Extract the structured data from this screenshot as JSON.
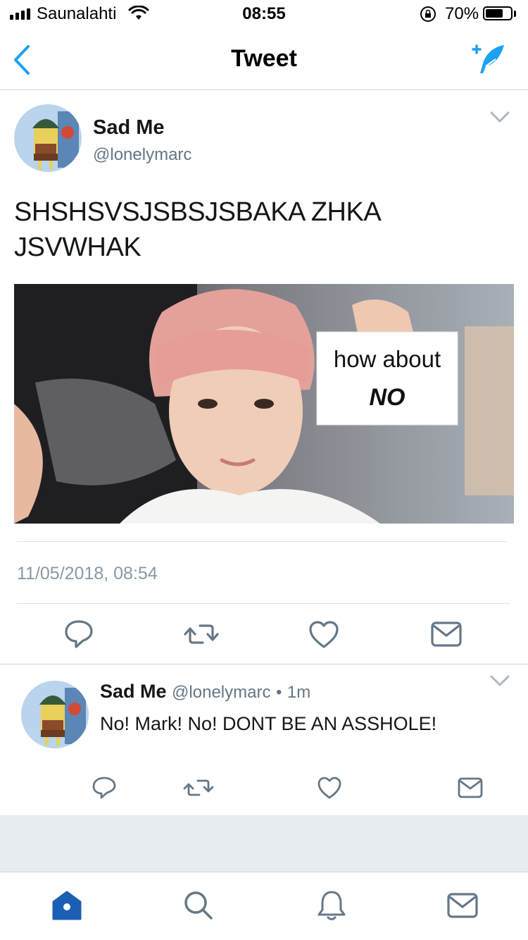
{
  "status_bar": {
    "carrier": "Saunalahti",
    "time": "08:55",
    "battery": "70%",
    "battery_level": 0.7
  },
  "nav": {
    "title": "Tweet",
    "back_icon": "chevron-left-icon",
    "compose_icon": "compose-tweet-icon"
  },
  "tweet": {
    "author_name": "Sad Me",
    "author_handle": "@lonelymarc",
    "text": "SHSHSVSJSBSJSBAKA ZHKA JSVWHAK",
    "media": {
      "sign_line1": "how about",
      "sign_line2": "NO"
    },
    "timestamp": "11/05/2018, 08:54"
  },
  "reply": {
    "author_name": "Sad Me",
    "author_handle": "@lonelymarc",
    "separator": "•",
    "time_ago": "1m",
    "text": "No! Mark! No! DONT BE AN ASSHOLE!"
  },
  "actions": [
    "reply-icon",
    "retweet-icon",
    "like-icon",
    "direct-message-icon"
  ],
  "tabs": [
    "home-icon",
    "search-icon",
    "notifications-icon",
    "messages-icon"
  ],
  "colors": {
    "accent": "#1da1f2",
    "home_active": "#1b5fb5",
    "icon_gray": "#657786",
    "text_secondary": "#657786",
    "divider": "#ccd6dd",
    "background_gray": "#e6ecf0"
  }
}
